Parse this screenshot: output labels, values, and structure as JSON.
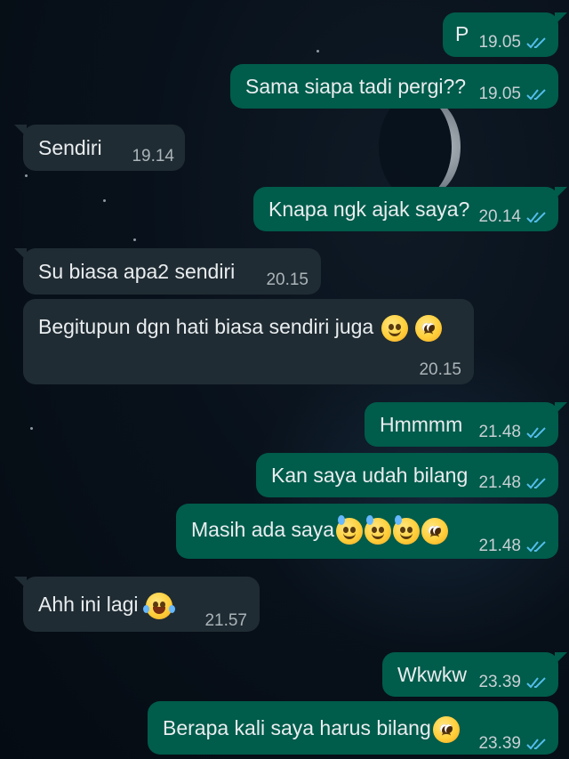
{
  "colors": {
    "outgoing_bubble": "#005c4b",
    "incoming_bubble": "#202c33",
    "read_tick": "#53bdeb",
    "text": "#e9edef"
  },
  "messages": [
    {
      "dir": "out",
      "text": "P",
      "time": "19.05",
      "status": "read"
    },
    {
      "dir": "out",
      "text": "Sama siapa tadi pergi??",
      "time": "19.05",
      "status": "read"
    },
    {
      "dir": "in",
      "text": "Sendiri",
      "time": "19.14"
    },
    {
      "dir": "out",
      "text": "Knapa ngk ajak saya?",
      "time": "20.14",
      "status": "read"
    },
    {
      "dir": "in",
      "text": "Su biasa apa2 sendiri",
      "time": "20.15"
    },
    {
      "dir": "in",
      "text": "Begitupun dgn hati biasa sendiri juga",
      "time": "20.15",
      "emojis": [
        "smiling-face",
        "pleading-face"
      ]
    },
    {
      "dir": "out",
      "text": "Hmmmm",
      "time": "21.48",
      "status": "read"
    },
    {
      "dir": "out",
      "text": "Kan saya udah bilang",
      "time": "21.48",
      "status": "read"
    },
    {
      "dir": "out",
      "text": "Masih ada saya",
      "time": "21.48",
      "status": "read",
      "emojis": [
        "grinning-sweat-face",
        "grinning-sweat-face",
        "grinning-sweat-face",
        "pleading-face"
      ]
    },
    {
      "dir": "in",
      "text": "Ahh ini lagi",
      "time": "21.57",
      "emojis": [
        "tears-of-joy-face"
      ]
    },
    {
      "dir": "out",
      "text": "Wkwkw",
      "time": "23.39",
      "status": "read"
    },
    {
      "dir": "out",
      "text": "Berapa kali saya harus bilang",
      "time": "23.39",
      "status": "read",
      "emojis": [
        "pleading-face"
      ]
    }
  ]
}
